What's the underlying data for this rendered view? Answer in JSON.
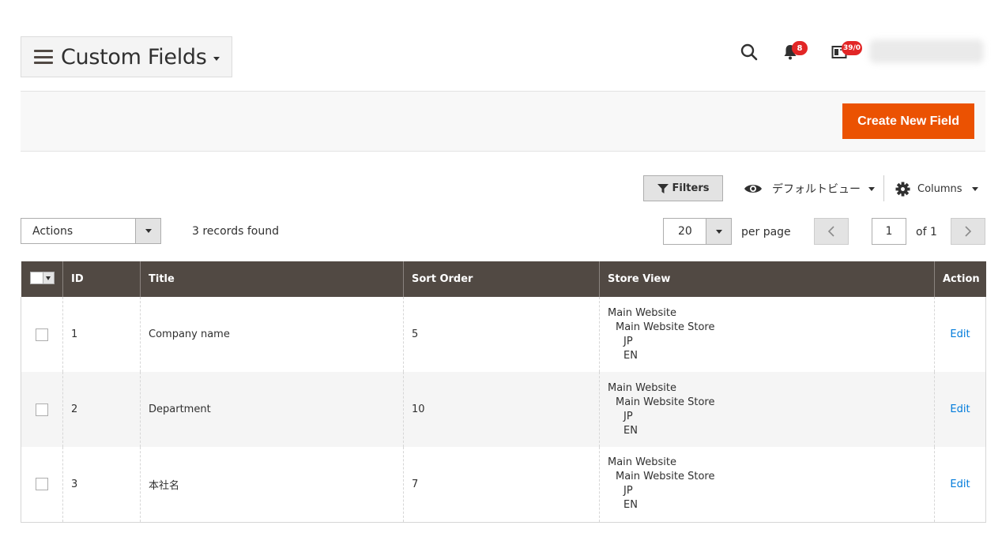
{
  "header": {
    "title": "Custom Fields",
    "notifications_count": "8",
    "system_messages_count": "39/0"
  },
  "action_bar": {
    "create_button_label": "Create New Field"
  },
  "toolbar": {
    "filters_label": "Filters",
    "view_label": "デフォルトビュー",
    "columns_label": "Columns",
    "actions_label": "Actions",
    "records_found": "3 records found",
    "per_page_value": "20",
    "per_page_label": "per page",
    "current_page": "1",
    "of_pages": "of 1"
  },
  "grid": {
    "columns": [
      "ID",
      "Title",
      "Sort Order",
      "Store View",
      "Action"
    ],
    "rows": [
      {
        "id": "1",
        "title": "Company name",
        "sort_order": "5",
        "store_view": [
          "Main Website",
          "Main Website Store",
          "JP",
          "EN"
        ],
        "action": "Edit"
      },
      {
        "id": "2",
        "title": "Department",
        "sort_order": "10",
        "store_view": [
          "Main Website",
          "Main Website Store",
          "JP",
          "EN"
        ],
        "action": "Edit"
      },
      {
        "id": "3",
        "title": "本社名",
        "sort_order": "7",
        "store_view": [
          "Main Website",
          "Main Website Store",
          "JP",
          "EN"
        ],
        "action": "Edit"
      }
    ]
  },
  "colors": {
    "accent": "#eb5202",
    "grid_header": "#514943",
    "badge": "#e22626",
    "link": "#007bdb"
  },
  "icons": [
    "menu-icon",
    "search-icon",
    "bell-icon",
    "system-messages-icon",
    "filter-icon",
    "eye-icon",
    "gear-icon",
    "chevron-left-icon",
    "chevron-right-icon"
  ]
}
